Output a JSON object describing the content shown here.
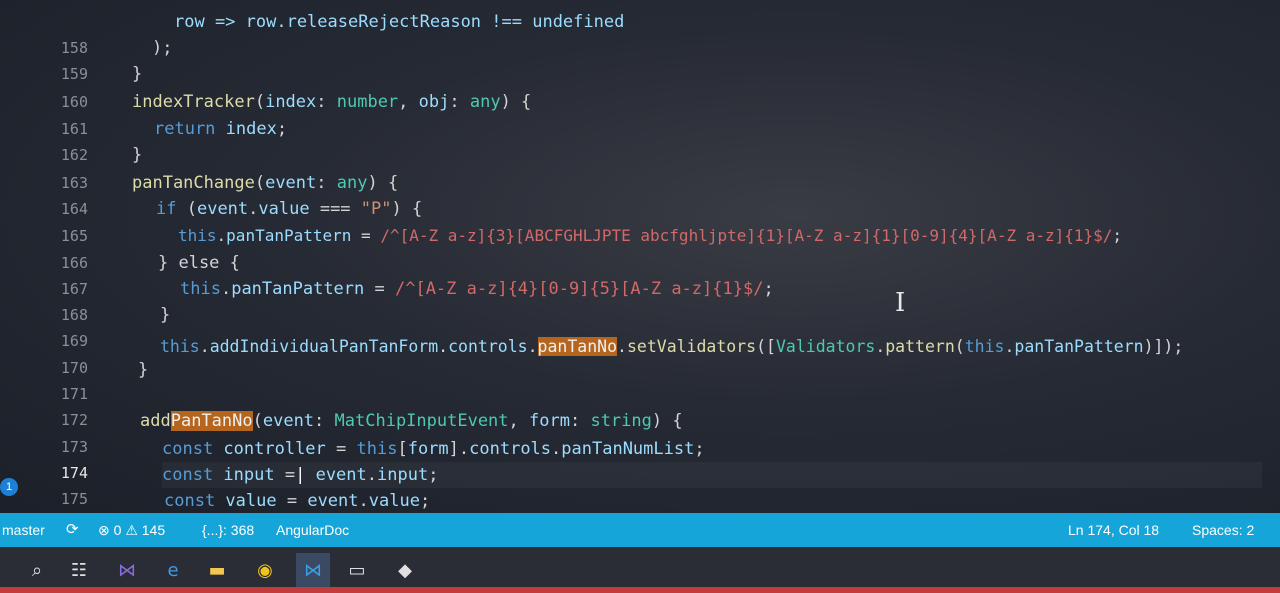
{
  "editor": {
    "line_numbers": [
      "158",
      "159",
      "160",
      "161",
      "162",
      "163",
      "164",
      "165",
      "166",
      "167",
      "168",
      "169",
      "170",
      "171",
      "172",
      "173",
      "174",
      "175"
    ],
    "active_line": "174",
    "top_fragment": "row => row.releaseRejectReason !== undefined",
    "lines": {
      "l158": ");",
      "l159": "}",
      "l160": [
        "indexTracker",
        "(",
        "index",
        ": ",
        "number",
        ", ",
        "obj",
        ": ",
        "any",
        ") {"
      ],
      "l161": [
        "return ",
        "index",
        ";"
      ],
      "l162": "}",
      "l163": [
        "panTanChange",
        "(",
        "event",
        ": ",
        "any",
        ") {"
      ],
      "l164": [
        "if ",
        "(",
        "event",
        ".",
        "value",
        " === ",
        "\"P\"",
        ") {"
      ],
      "l165": [
        "this",
        ".",
        "panTanPattern",
        " = ",
        "/^[A-Z a-z]{3}[ABCFGHLJPTE abcfghljpte]{1}[A-Z a-z]{1}[0-9]{4}[A-Z a-z]{1}$/",
        ";"
      ],
      "l166": "} else {",
      "l167": [
        "this",
        ".",
        "panTanPattern",
        " = ",
        "/^[A-Z a-z]{4}[0-9]{5}[A-Z a-z]{1}$/",
        ";"
      ],
      "l168": "}",
      "l169": [
        "this",
        ".",
        "addIndividualPanTanForm",
        ".",
        "controls",
        ".",
        "panTanNo",
        ".",
        "setValidators",
        "([",
        "Validators",
        ".",
        "pattern",
        "(",
        "this",
        ".",
        "panTanPattern",
        ")]);"
      ],
      "l170": "}",
      "l172": [
        "add",
        "PanTanNo",
        "(",
        "event",
        ": ",
        "MatChipInputEvent",
        ", ",
        "form",
        ": ",
        "string",
        ") {"
      ],
      "l173": [
        "const ",
        "controller",
        " = ",
        "this",
        "[",
        "form",
        "].",
        "controls",
        ".",
        "panTanNumList",
        ";"
      ],
      "l174": [
        "const ",
        "input",
        " =",
        "|",
        " event",
        ".",
        "input",
        ";"
      ],
      "l175": [
        "const ",
        "value",
        " = ",
        "event",
        ".",
        "value",
        ";"
      ]
    }
  },
  "fold_badge": "1",
  "statusbar": {
    "branch": "master",
    "errors": "0",
    "warnings": "145",
    "braces": "{...}: 368",
    "extension": "AngularDoc",
    "position": "Ln 174, Col 18",
    "spaces": "Spaces: 2"
  },
  "taskbar": {
    "items": [
      "search-icon",
      "task-view-icon",
      "visual-studio-icon",
      "edge-icon",
      "file-explorer-icon",
      "chrome-icon",
      "vscode-icon",
      "terminal-icon",
      "git-icon"
    ]
  },
  "colors": {
    "statusbar": "#16a5d9",
    "editor_bg": "#262a34",
    "keyword": "#569cd6",
    "function": "#dcdcaa",
    "property": "#9cdcfe",
    "type": "#4ec9b0",
    "string": "#ce9178",
    "regex": "#d16969",
    "highlight": "#b5651d"
  }
}
